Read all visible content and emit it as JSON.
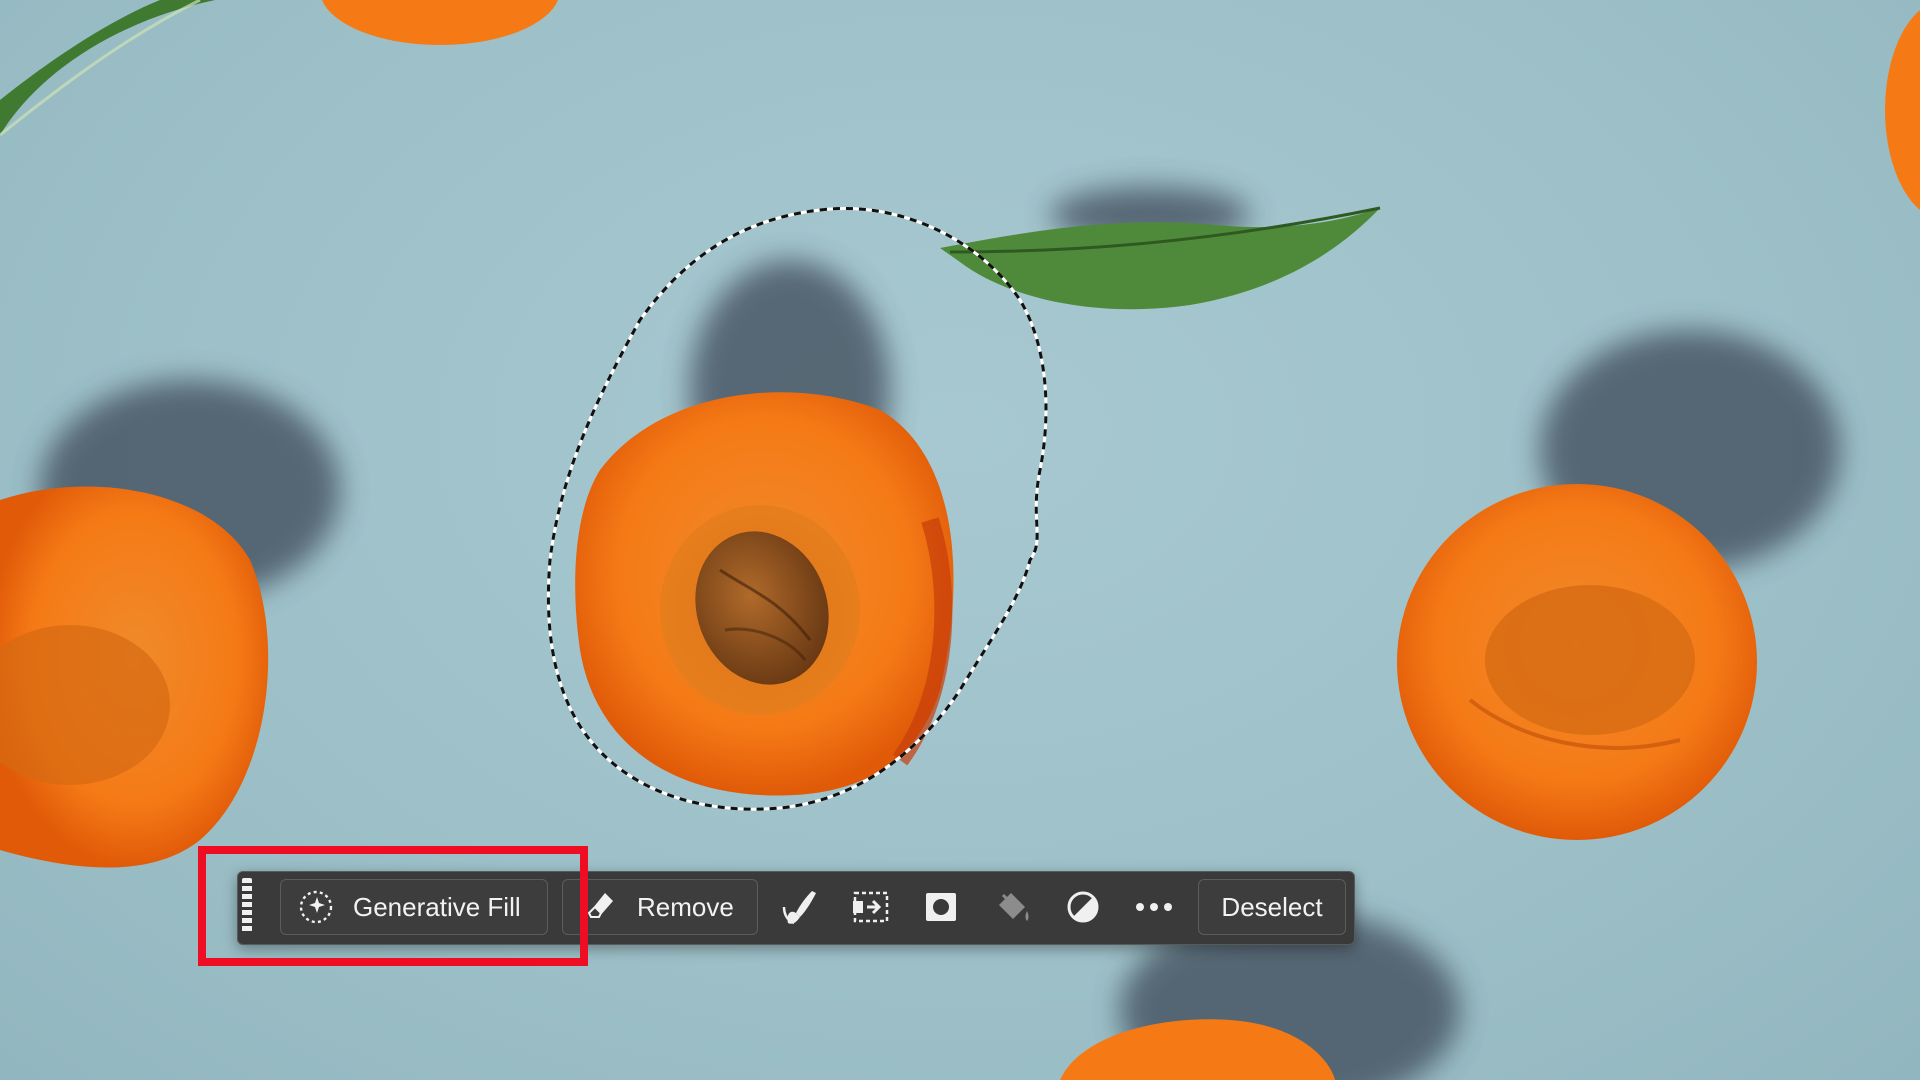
{
  "canvas": {
    "background_color": "#9fc2ca",
    "fruit_color": "#f57a16",
    "leaf_color": "#4f8a3a"
  },
  "taskbar": {
    "grip_icon": "drag-handle-icon",
    "generative_fill": {
      "label": "Generative Fill",
      "icon": "generative-fill-sparkle-icon"
    },
    "remove": {
      "label": "Remove",
      "icon": "eraser-icon"
    },
    "tools": [
      {
        "name": "modify-selection-brush-icon"
      },
      {
        "name": "transform-selection-icon"
      },
      {
        "name": "create-mask-icon"
      },
      {
        "name": "fill-selection-bucket-icon"
      },
      {
        "name": "adjustment-layer-icon"
      },
      {
        "name": "more-options-icon"
      }
    ],
    "deselect": {
      "label": "Deselect"
    }
  },
  "annotation": {
    "highlight_color": "#ee0d22"
  }
}
